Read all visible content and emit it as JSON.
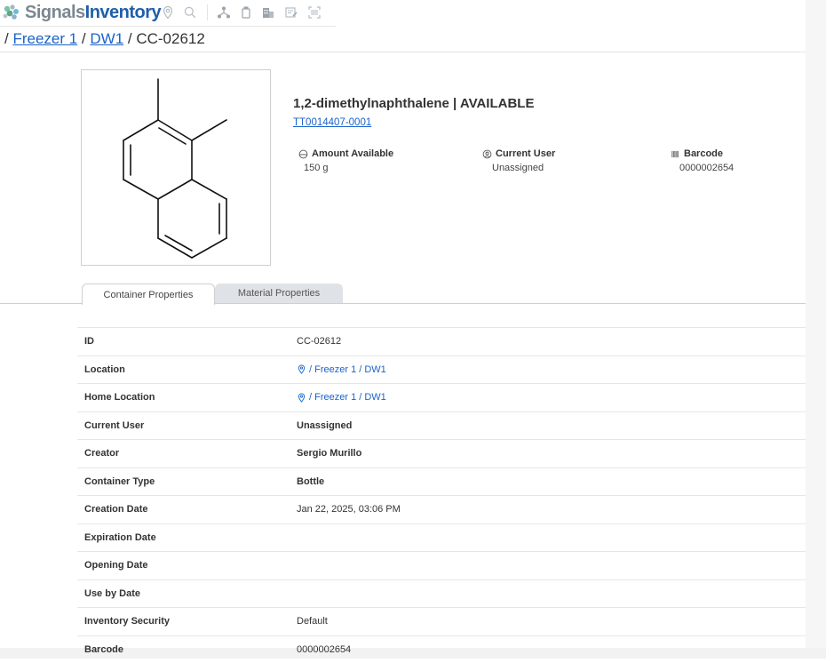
{
  "app": {
    "brand_part1": "Signals",
    "brand_part2": "Inventory"
  },
  "toolbar": {
    "icons": [
      "location-icon",
      "search-icon",
      "hierarchy-icon",
      "container-icon",
      "building-icon",
      "edit-note-icon",
      "barcode-scan-icon"
    ]
  },
  "breadcrumb": {
    "sep1": "/ ",
    "item1": "Freezer 1",
    "sep2": " / ",
    "item2": "DW1",
    "sep3": " / ",
    "current": "CC-02612"
  },
  "material": {
    "title": "1,2-dimethylnaphthalene | AVAILABLE",
    "id_link": "TT0014407-0001"
  },
  "stats": {
    "amount_label": "Amount Available",
    "amount_value": "150 g",
    "user_label": "Current User",
    "user_value": "Unassigned",
    "barcode_label": "Barcode",
    "barcode_value": "0000002654"
  },
  "tabs": {
    "container": "Container Properties",
    "material": "Material Properties"
  },
  "properties": {
    "id": {
      "label": "ID",
      "value": "CC-02612"
    },
    "location": {
      "label": "Location",
      "value": "/ Freezer 1 / DW1"
    },
    "home_location": {
      "label": "Home Location",
      "value": "/ Freezer 1 / DW1"
    },
    "current_user": {
      "label": "Current User",
      "value": "Unassigned"
    },
    "creator": {
      "label": "Creator",
      "value": "Sergio Murillo"
    },
    "container_type": {
      "label": "Container Type",
      "value": "Bottle"
    },
    "creation_date": {
      "label": "Creation Date",
      "value": "Jan 22, 2025, 03:06 PM"
    },
    "expiration_date": {
      "label": "Expiration Date",
      "value": ""
    },
    "opening_date": {
      "label": "Opening Date",
      "value": ""
    },
    "use_by_date": {
      "label": "Use by Date",
      "value": ""
    },
    "inventory_security": {
      "label": "Inventory Security",
      "value": "Default"
    },
    "barcode": {
      "label": "Barcode",
      "value": "0000002654"
    }
  }
}
